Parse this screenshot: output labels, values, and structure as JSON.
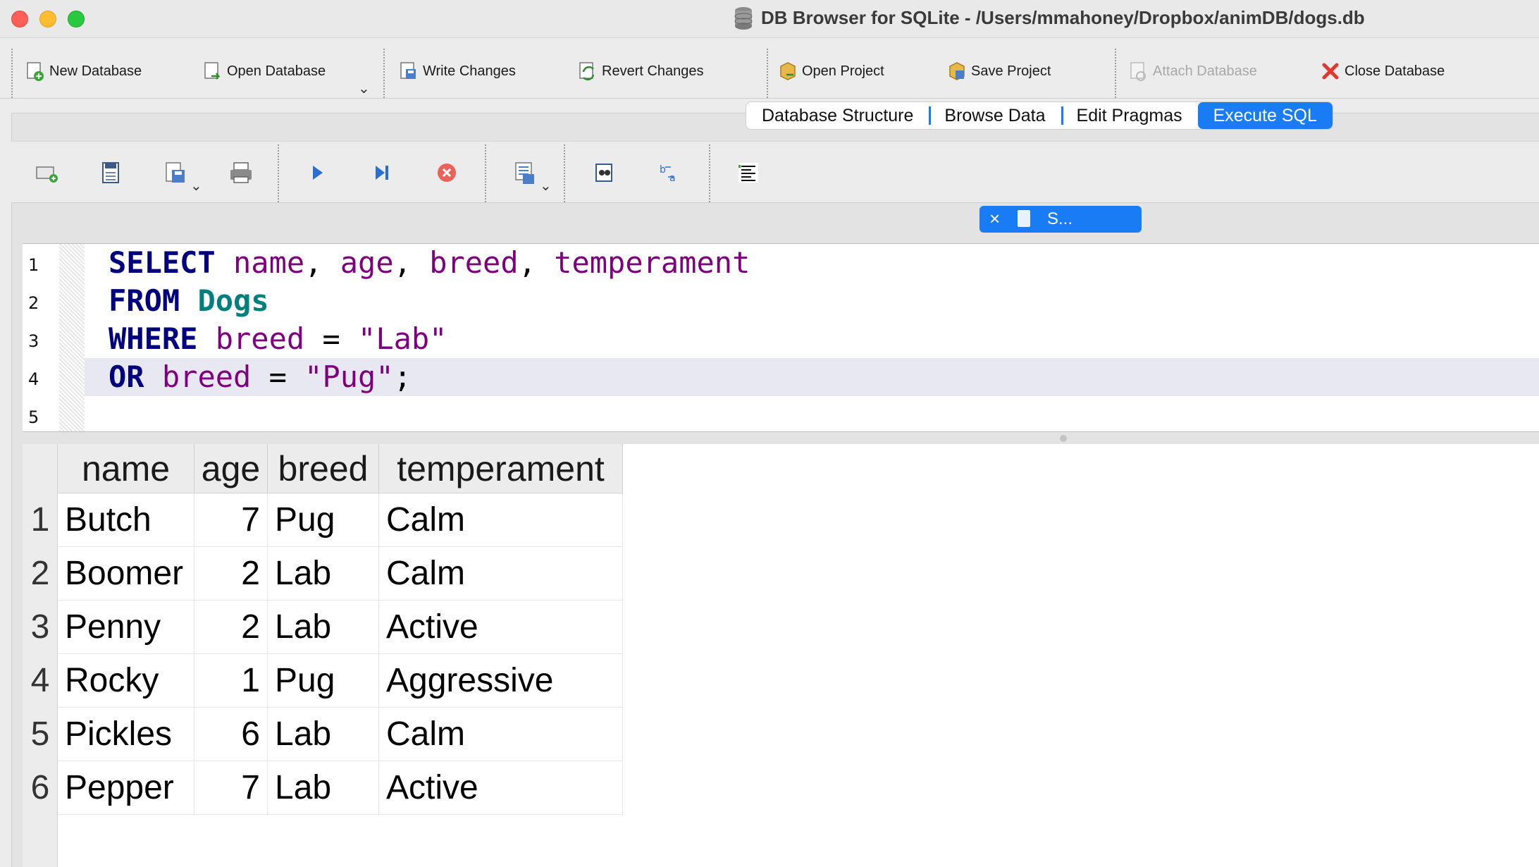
{
  "window": {
    "title": "DB Browser for SQLite - /Users/mmahoney/Dropbox/animDB/dogs.db"
  },
  "toolbar": {
    "new_database": "New Database",
    "open_database": "Open Database",
    "write_changes": "Write Changes",
    "revert_changes": "Revert Changes",
    "open_project": "Open Project",
    "save_project": "Save Project",
    "attach_database": "Attach Database",
    "close_database": "Close Database"
  },
  "tabs": [
    {
      "label": "Database Structure",
      "active": false
    },
    {
      "label": "Browse Data",
      "active": false
    },
    {
      "label": "Edit Pragmas",
      "active": false
    },
    {
      "label": "Execute SQL",
      "active": true
    }
  ],
  "sql_tab": {
    "label": "S...",
    "close": "×"
  },
  "editor": {
    "line_numbers": [
      "1",
      "2",
      "3",
      "4",
      "5"
    ],
    "lines": [
      [
        {
          "t": "SELECT",
          "c": "kw"
        },
        {
          "t": " ",
          "c": "op"
        },
        {
          "t": "name",
          "c": "id"
        },
        {
          "t": ", ",
          "c": "op"
        },
        {
          "t": "age",
          "c": "id"
        },
        {
          "t": ", ",
          "c": "op"
        },
        {
          "t": "breed",
          "c": "id"
        },
        {
          "t": ", ",
          "c": "op"
        },
        {
          "t": "temperament",
          "c": "id"
        }
      ],
      [
        {
          "t": "FROM",
          "c": "kw"
        },
        {
          "t": " ",
          "c": "op"
        },
        {
          "t": "Dogs",
          "c": "tbl"
        }
      ],
      [
        {
          "t": "WHERE",
          "c": "kw"
        },
        {
          "t": " ",
          "c": "op"
        },
        {
          "t": "breed",
          "c": "id"
        },
        {
          "t": " = ",
          "c": "op"
        },
        {
          "t": "\"Lab\"",
          "c": "str"
        }
      ],
      [
        {
          "t": "OR",
          "c": "kw"
        },
        {
          "t": " ",
          "c": "op"
        },
        {
          "t": "breed",
          "c": "id"
        },
        {
          "t": " = ",
          "c": "op"
        },
        {
          "t": "\"Pug\"",
          "c": "str"
        },
        {
          "t": ";",
          "c": "op"
        }
      ],
      []
    ],
    "current_line": 4
  },
  "results": {
    "columns": [
      "name",
      "age",
      "breed",
      "temperament"
    ],
    "rows": [
      {
        "n": "1",
        "cells": [
          "Butch",
          "7",
          "Pug",
          "Calm"
        ]
      },
      {
        "n": "2",
        "cells": [
          "Boomer",
          "2",
          "Lab",
          "Calm"
        ]
      },
      {
        "n": "3",
        "cells": [
          "Penny",
          "2",
          "Lab",
          "Active"
        ]
      },
      {
        "n": "4",
        "cells": [
          "Rocky",
          "1",
          "Pug",
          "Aggressive"
        ]
      },
      {
        "n": "5",
        "cells": [
          "Pickles",
          "6",
          "Lab",
          "Calm"
        ]
      },
      {
        "n": "6",
        "cells": [
          "Pepper",
          "7",
          "Lab",
          "Active"
        ]
      }
    ]
  },
  "icons": {
    "db_icon": "database-icon",
    "execute_all": "play-icon",
    "execute_current": "step-play-icon",
    "stop": "stop-icon"
  }
}
